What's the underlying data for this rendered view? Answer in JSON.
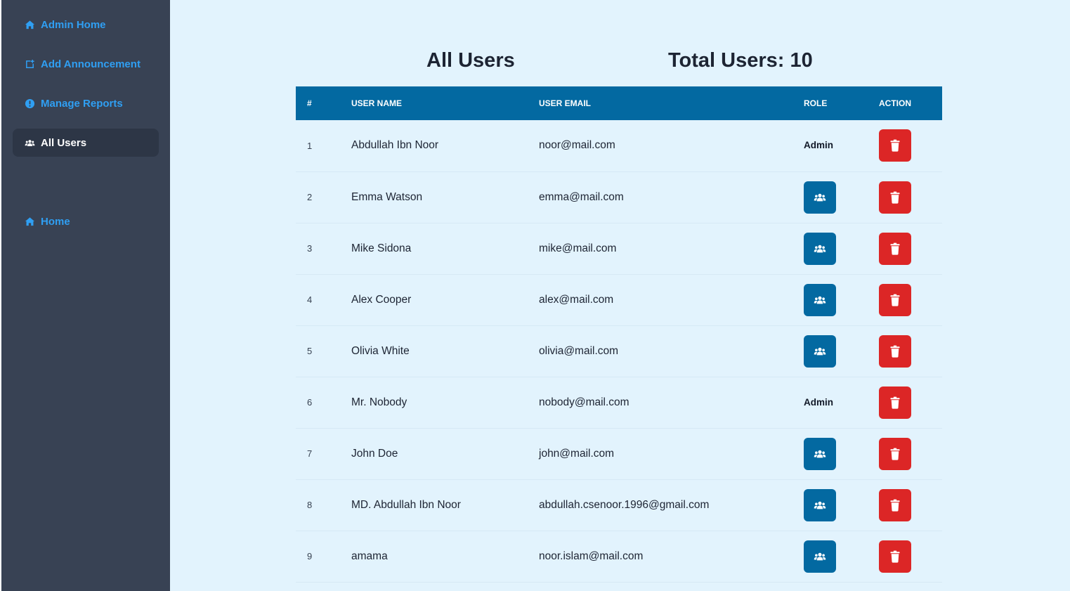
{
  "sidebar": {
    "items": [
      {
        "label": "Admin Home",
        "icon": "home-icon",
        "active": false
      },
      {
        "label": "Add Announcement",
        "icon": "add-announcement-icon",
        "active": false
      },
      {
        "label": "Manage Reports",
        "icon": "exclamation-icon",
        "active": false
      },
      {
        "label": "All Users",
        "icon": "users-icon",
        "active": true
      }
    ],
    "secondary": [
      {
        "label": "Home",
        "icon": "home-icon",
        "active": false
      }
    ]
  },
  "main": {
    "title": "All Users",
    "total": "Total Users: 10"
  },
  "table": {
    "headers": [
      "#",
      "USER NAME",
      "USER EMAIL",
      "ROLE",
      "ACTION"
    ],
    "rows": [
      {
        "num": "1",
        "name": "Abdullah Ibn Noor",
        "email": "noor@mail.com",
        "role": "Admin"
      },
      {
        "num": "2",
        "name": "Emma Watson",
        "email": "emma@mail.com",
        "role": ""
      },
      {
        "num": "3",
        "name": "Mike Sidona",
        "email": "mike@mail.com",
        "role": ""
      },
      {
        "num": "4",
        "name": "Alex Cooper",
        "email": "alex@mail.com",
        "role": ""
      },
      {
        "num": "5",
        "name": "Olivia White",
        "email": "olivia@mail.com",
        "role": ""
      },
      {
        "num": "6",
        "name": "Mr. Nobody",
        "email": "nobody@mail.com",
        "role": "Admin"
      },
      {
        "num": "7",
        "name": "John Doe",
        "email": "john@mail.com",
        "role": ""
      },
      {
        "num": "8",
        "name": "MD. Abdullah Ibn Noor",
        "email": "abdullah.csenoor.1996@gmail.com",
        "role": ""
      },
      {
        "num": "9",
        "name": "amama",
        "email": "noor.islam@mail.com",
        "role": ""
      }
    ]
  },
  "colors": {
    "sidebar_bg": "#384254",
    "link": "#2f9ff3",
    "main_bg": "#e2f3fd",
    "header_bg": "#0369a1",
    "delete": "#dc2626"
  }
}
